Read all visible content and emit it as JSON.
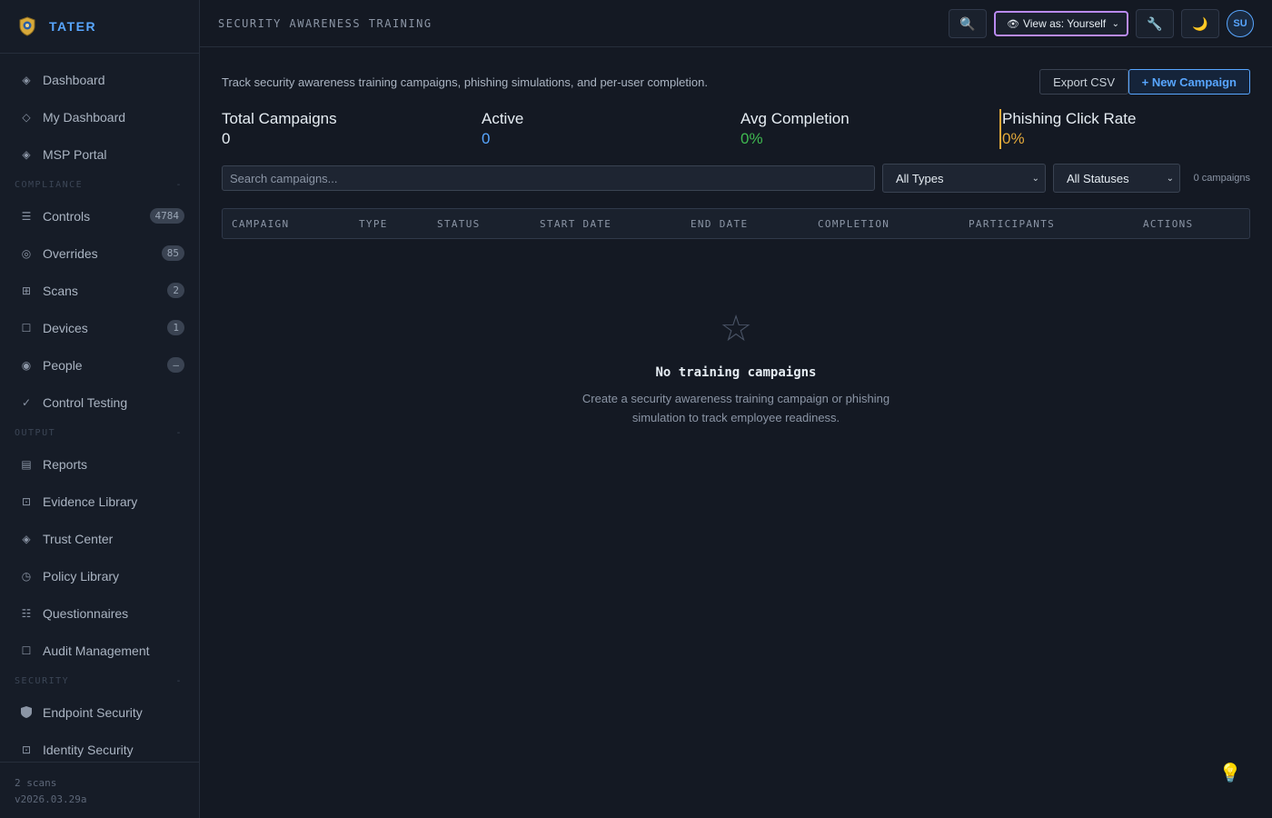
{
  "brand": {
    "name": "TATER"
  },
  "sidebar": {
    "items_top": [
      {
        "label": "Dashboard",
        "icon": "diamond-icon"
      },
      {
        "label": "My Dashboard",
        "icon": "diamond-outline-icon"
      },
      {
        "label": "MSP Portal",
        "icon": "diamond-icon"
      }
    ],
    "sections": {
      "compliance": "COMPLIANCE",
      "output": "OUTPUT",
      "security": "SECURITY"
    },
    "compliance_items": [
      {
        "label": "Controls",
        "badge": "4784"
      },
      {
        "label": "Overrides",
        "badge": "85"
      },
      {
        "label": "Scans",
        "badge": "2"
      },
      {
        "label": "Devices",
        "badge": "1"
      },
      {
        "label": "People",
        "badge": "–"
      },
      {
        "label": "Control Testing",
        "badge": ""
      }
    ],
    "output_items": [
      {
        "label": "Reports"
      },
      {
        "label": "Evidence Library"
      },
      {
        "label": "Trust Center"
      },
      {
        "label": "Policy Library"
      },
      {
        "label": "Questionnaires"
      },
      {
        "label": "Audit Management"
      }
    ],
    "security_items": [
      {
        "label": "Endpoint Security"
      },
      {
        "label": "Identity Security"
      }
    ],
    "section_toggle": "-",
    "footer": {
      "scans": "2 scans",
      "version": "v2026.03.29a"
    }
  },
  "topbar": {
    "title": "SECURITY AWARENESS TRAINING",
    "view_as": "View as: Yourself",
    "avatar": "SU"
  },
  "main": {
    "description": "Track security awareness training campaigns, phishing simulations, and per-user completion.",
    "export_label": "Export CSV",
    "new_label": "+ New Campaign",
    "stats": [
      {
        "label": "Total Campaigns",
        "value": "0",
        "color": "#e6edf3"
      },
      {
        "label": "Active",
        "value": "0",
        "color": "#58a6ff"
      },
      {
        "label": "Avg Completion",
        "value": "0%",
        "color": "#3fb950"
      },
      {
        "label": "Phishing Click Rate",
        "value": "0%",
        "color": "#e3a93a"
      }
    ],
    "search_placeholder": "Search campaigns...",
    "type_filter": "All Types",
    "status_filter": "All Statuses",
    "count": "0 campaigns",
    "columns": [
      "CAMPAIGN",
      "TYPE",
      "STATUS",
      "START DATE",
      "END DATE",
      "COMPLETION",
      "PARTICIPANTS",
      "ACTIONS"
    ],
    "empty": {
      "title": "No training campaigns",
      "line1": "Create a security awareness training campaign or phishing",
      "line2": "simulation to track employee readiness."
    }
  }
}
